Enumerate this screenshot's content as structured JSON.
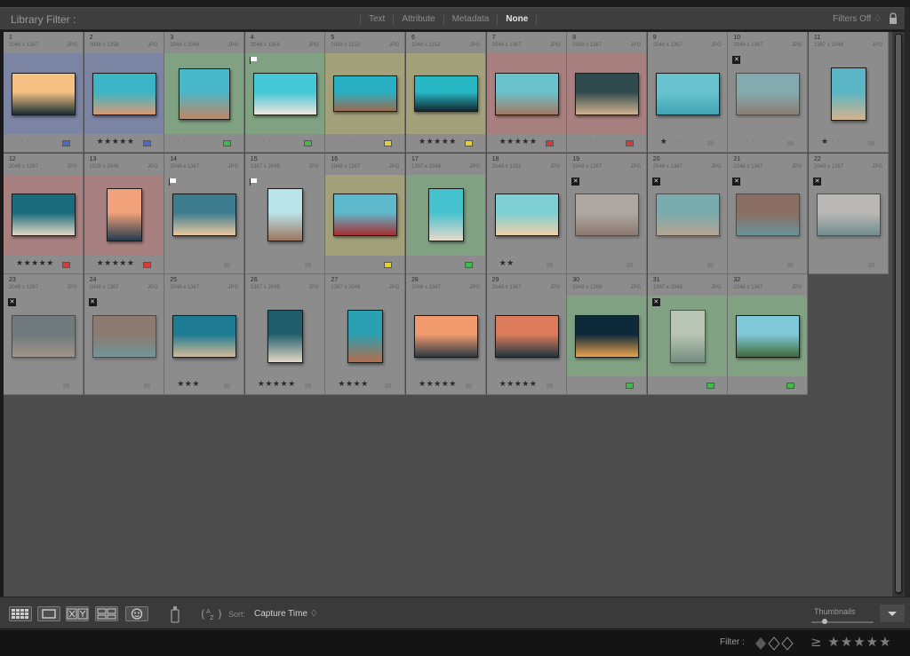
{
  "filter_bar": {
    "title": "Library Filter :",
    "tabs": [
      "Text",
      "Attribute",
      "Metadata",
      "None"
    ],
    "active_tab": "None",
    "filters_off": "Filters Off ♢"
  },
  "colors": {
    "blue": "#4f67c8",
    "green": "#42b84a",
    "yellow": "#e4d034",
    "red": "#d43c3c",
    "gray": "#7a7a7a",
    "bg_blue": "#7b84a3",
    "bg_green": "#80a282",
    "bg_yellow": "#a3a17a",
    "bg_red": "#a98080",
    "bg_none": "#8c8c8c"
  },
  "photos": [
    {
      "num": "1",
      "dims": "2048 x 1367",
      "ext": "JPG",
      "stars": 0,
      "label": "blue",
      "flag": "none",
      "orientation": "landscape",
      "colors": [
        "#f4c183",
        "#1a2f33"
      ],
      "icon": "sunset-forest-photo-icon"
    },
    {
      "num": "2",
      "dims": "2048 x 1356",
      "ext": "JPG",
      "stars": 5,
      "label": "blue",
      "flag": "none",
      "orientation": "landscape",
      "colors": [
        "#3ab5c5",
        "#d99a74"
      ],
      "icon": "desert-hill-photo-icon"
    },
    {
      "num": "3",
      "dims": "2048 x 2048",
      "ext": "JPG",
      "stars": 0,
      "label": "green",
      "flag": "none",
      "orientation": "square",
      "colors": [
        "#49b8c8",
        "#c08666"
      ],
      "icon": "rocky-hill-photo-icon"
    },
    {
      "num": "4",
      "dims": "2048 x 1356",
      "ext": "JPG",
      "stars": 0,
      "label": "green",
      "flag": "pick",
      "orientation": "landscape",
      "colors": [
        "#44c7d6",
        "#efe6dc"
      ],
      "icon": "person-rocks-photo-icon"
    },
    {
      "num": "5",
      "dims": "2048 x 1152",
      "ext": "JPG",
      "stars": 0,
      "label": "yellow",
      "flag": "none",
      "orientation": "landscape-wide",
      "colors": [
        "#2ab0c4",
        "#9a6a4e"
      ],
      "icon": "canyon-road-photo-icon"
    },
    {
      "num": "6",
      "dims": "2048 x 1152",
      "ext": "JPG",
      "stars": 5,
      "label": "yellow",
      "flag": "none",
      "orientation": "landscape-wide",
      "colors": [
        "#28b8c5",
        "#12292f"
      ],
      "icon": "concert-lights-photo-icon"
    },
    {
      "num": "7",
      "dims": "2048 x 1367",
      "ext": "JPG",
      "stars": 5,
      "label": "red",
      "flag": "none",
      "orientation": "landscape",
      "colors": [
        "#6ac2cc",
        "#a37860"
      ],
      "icon": "car-palms-photo-icon"
    },
    {
      "num": "8",
      "dims": "2048 x 1367",
      "ext": "JPG",
      "stars": 0,
      "label": "red",
      "flag": "none",
      "orientation": "landscape",
      "colors": [
        "#2f4b4d",
        "#d2b290"
      ],
      "icon": "boat-shore-photo-icon"
    },
    {
      "num": "9",
      "dims": "2048 x 1367",
      "ext": "JPG",
      "stars": 1,
      "label": "none",
      "flag": "none",
      "orientation": "landscape",
      "colors": [
        "#69c3cf",
        "#3fa4b4"
      ],
      "icon": "airplane-photo-icon"
    },
    {
      "num": "10",
      "dims": "2048 x 1367",
      "ext": "JPG",
      "stars": 0,
      "label": "none",
      "flag": "reject",
      "orientation": "landscape",
      "colors": [
        "#7cc6cc",
        "#8f7060"
      ],
      "icon": "palm-leaf-photo-icon"
    },
    {
      "num": "11",
      "dims": "1367 x 2048",
      "ext": "JPG",
      "stars": 1,
      "label": "none",
      "flag": "none",
      "orientation": "portrait",
      "colors": [
        "#5ab5c4",
        "#d4b48f"
      ],
      "icon": "tower-street-photo-icon"
    },
    {
      "num": "12",
      "dims": "2048 x 1367",
      "ext": "JPG",
      "stars": 5,
      "label": "red",
      "flag": "none",
      "orientation": "landscape",
      "colors": [
        "#1a6c7c",
        "#e3d6c5"
      ],
      "icon": "skyscraper-photo-icon"
    },
    {
      "num": "13",
      "dims": "1529 x 2048",
      "ext": "JPG",
      "stars": 5,
      "label": "red",
      "flag": "none",
      "orientation": "portrait",
      "colors": [
        "#f2a27a",
        "#233a4e"
      ],
      "icon": "paraglider-sunset-photo-icon"
    },
    {
      "num": "14",
      "dims": "2048 x 1367",
      "ext": "JPG",
      "stars": 0,
      "label": "none",
      "flag": "pick",
      "orientation": "landscape",
      "colors": [
        "#3d7c8e",
        "#e9c79f"
      ],
      "icon": "coast-clouds-photo-icon"
    },
    {
      "num": "15",
      "dims": "1367 x 2048",
      "ext": "JPG",
      "stars": 0,
      "label": "none",
      "flag": "pick",
      "orientation": "portrait",
      "colors": [
        "#b9e4ea",
        "#9d7560"
      ],
      "icon": "mountain-road-photo-icon"
    },
    {
      "num": "16",
      "dims": "2048 x 1367",
      "ext": "JPG",
      "stars": 0,
      "label": "yellow",
      "flag": "none",
      "orientation": "landscape",
      "colors": [
        "#5fb9cc",
        "#a62e32"
      ],
      "icon": "red-truck-photo-icon"
    },
    {
      "num": "17",
      "dims": "1367 x 2048",
      "ext": "JPG",
      "stars": 0,
      "label": "green",
      "flag": "none",
      "orientation": "portrait",
      "colors": [
        "#46c2cf",
        "#e7d9cb"
      ],
      "icon": "beach-dunes-photo-icon"
    },
    {
      "num": "18",
      "dims": "2048 x 1391",
      "ext": "JPG",
      "stars": 2,
      "label": "none",
      "flag": "none",
      "orientation": "landscape",
      "colors": [
        "#7ed0d4",
        "#edcfa8"
      ],
      "icon": "lifeguard-tower-photo-icon"
    },
    {
      "num": "19",
      "dims": "2048 x 1367",
      "ext": "JPG",
      "stars": 0,
      "label": "none",
      "flag": "reject",
      "orientation": "landscape",
      "colors": [
        "#ccbfb4",
        "#8b6a58"
      ],
      "icon": "woman-wall-photo-icon"
    },
    {
      "num": "20",
      "dims": "2048 x 1367",
      "ext": "JPG",
      "stars": 0,
      "label": "none",
      "flag": "reject",
      "orientation": "landscape",
      "colors": [
        "#6cc6cc",
        "#d9b797"
      ],
      "icon": "tree-field-photo-icon"
    },
    {
      "num": "21",
      "dims": "2048 x 1367",
      "ext": "JPG",
      "stars": 0,
      "label": "none",
      "flag": "reject",
      "orientation": "landscape",
      "colors": [
        "#8a5442",
        "#4f9aa2"
      ],
      "icon": "palm-trees-photo-icon"
    },
    {
      "num": "22",
      "dims": "2048 x 1367",
      "ext": "JPG",
      "stars": 0,
      "label": "none",
      "flag": "reject",
      "orientation": "landscape",
      "colors": [
        "#dfdcd5",
        "#5f8f94"
      ],
      "icon": "selfie-group-photo-icon"
    },
    {
      "num": "23",
      "dims": "2048 x 1367",
      "ext": "JPG",
      "stars": 0,
      "label": "none",
      "flag": "reject",
      "orientation": "landscape",
      "colors": [
        "#596b73",
        "#b19c88"
      ],
      "icon": "seaside-town-photo-icon"
    },
    {
      "num": "24",
      "dims": "2048 x 1367",
      "ext": "JPG",
      "stars": 0,
      "label": "none",
      "flag": "reject",
      "orientation": "landscape",
      "colors": [
        "#8d6c5b",
        "#5a9fa6"
      ],
      "icon": "flower-bush-photo-icon"
    },
    {
      "num": "25",
      "dims": "2048 x 1367",
      "ext": "JPG",
      "stars": 3,
      "label": "none",
      "flag": "none",
      "orientation": "landscape",
      "colors": [
        "#1e7b94",
        "#d3b995"
      ],
      "icon": "hotel-palms-photo-icon"
    },
    {
      "num": "26",
      "dims": "1367 x 2048",
      "ext": "JPG",
      "stars": 5,
      "label": "none",
      "flag": "none",
      "orientation": "portrait",
      "colors": [
        "#1f5d6c",
        "#e4d7c4"
      ],
      "icon": "building-corner-photo-icon"
    },
    {
      "num": "27",
      "dims": "1367 x 2048",
      "ext": "JPG",
      "stars": 4,
      "label": "none",
      "flag": "none",
      "orientation": "portrait",
      "colors": [
        "#2ba0b3",
        "#b36d4c"
      ],
      "icon": "palm-closeup-photo-icon"
    },
    {
      "num": "28",
      "dims": "2048 x 1367",
      "ext": "JPG",
      "stars": 5,
      "label": "none",
      "flag": "none",
      "orientation": "landscape",
      "colors": [
        "#f09a6e",
        "#2c3a44"
      ],
      "icon": "pier-sunset-photo-icon"
    },
    {
      "num": "29",
      "dims": "2048 x 1367",
      "ext": "JPG",
      "stars": 5,
      "label": "none",
      "flag": "none",
      "orientation": "landscape",
      "colors": [
        "#dc7b5b",
        "#1f3640"
      ],
      "icon": "marina-dusk-photo-icon"
    },
    {
      "num": "30",
      "dims": "2048 x 1366",
      "ext": "JPG",
      "stars": 0,
      "label": "green",
      "flag": "none",
      "orientation": "landscape",
      "colors": [
        "#0e2a3a",
        "#e8a14d"
      ],
      "icon": "carousel-night-photo-icon"
    },
    {
      "num": "31",
      "dims": "1367 x 2048",
      "ext": "JPG",
      "stars": 0,
      "label": "green",
      "flag": "reject",
      "orientation": "portrait",
      "colors": [
        "#e7e3dd",
        "#6e7d80"
      ],
      "icon": "man-portrait-photo-icon"
    },
    {
      "num": "32",
      "dims": "2048 x 1367",
      "ext": "JPG",
      "stars": 0,
      "label": "green",
      "flag": "none",
      "orientation": "landscape",
      "colors": [
        "#7ec8d8",
        "#3f6b3b"
      ],
      "icon": "park-people-photo-icon"
    }
  ],
  "toolbar": {
    "sort_label": "Sort:",
    "sort_value": "Capture Time ♢",
    "thumbnails_label": "Thumbnails"
  },
  "status": {
    "filter_label": "Filter :",
    "filter_stars": "≥ ★★★★★"
  }
}
